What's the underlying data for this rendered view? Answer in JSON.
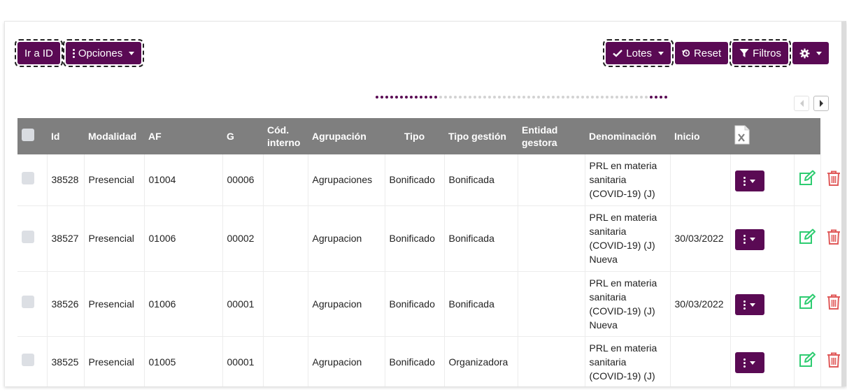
{
  "toolbar": {
    "go_to_id": "Ir a ID",
    "options": "Opciones",
    "lotes": "Lotes",
    "reset": "Reset",
    "filters": "Filtros"
  },
  "colors": {
    "primary": "#5a0a54",
    "header_bg": "#7f7f7f",
    "edit": "#2ecc71",
    "delete": "#e05a5a"
  },
  "table": {
    "headers": {
      "id": "Id",
      "modalidad": "Modalidad",
      "af": "AF",
      "g": "G",
      "cod_interno": "Cód. interno",
      "agrupacion": "Agrupación",
      "tipo": "Tipo",
      "tipo_gestion": "Tipo gestión",
      "entidad_gestora": "Entidad gestora",
      "denominacion": "Denominación",
      "inicio": "Inicio"
    },
    "export_icon": "excel-export-icon",
    "rows": [
      {
        "id": "38528",
        "modalidad": "Presencial",
        "af": "01004",
        "g": "00006",
        "cod_interno": "",
        "agrupacion": "Agrupaciones",
        "tipo": "Bonificado",
        "tipo_gestion": "Bonificada",
        "entidad_gestora": "",
        "denominacion": "PRL en materia sanitaria (COVID-19) (J)",
        "inicio": ""
      },
      {
        "id": "38527",
        "modalidad": "Presencial",
        "af": "01006",
        "g": "00002",
        "cod_interno": "",
        "agrupacion": "Agrupacion",
        "tipo": "Bonificado",
        "tipo_gestion": "Bonificada",
        "entidad_gestora": "",
        "denominacion": "PRL en materia sanitaria (COVID-19) (J) Nueva",
        "inicio": "30/03/2022"
      },
      {
        "id": "38526",
        "modalidad": "Presencial",
        "af": "01006",
        "g": "00001",
        "cod_interno": "",
        "agrupacion": "Agrupacion",
        "tipo": "Bonificado",
        "tipo_gestion": "Bonificada",
        "entidad_gestora": "",
        "denominacion": "PRL en materia sanitaria (COVID-19) (J) Nueva",
        "inicio": "30/03/2022"
      },
      {
        "id": "38525",
        "modalidad": "Presencial",
        "af": "01005",
        "g": "00001",
        "cod_interno": "",
        "agrupacion": "Agrupacion",
        "tipo": "Bonificado",
        "tipo_gestion": "Organizadora",
        "entidad_gestora": "",
        "denominacion": "PRL en materia sanitaria (COVID-19) (J)",
        "inicio": ""
      }
    ]
  }
}
